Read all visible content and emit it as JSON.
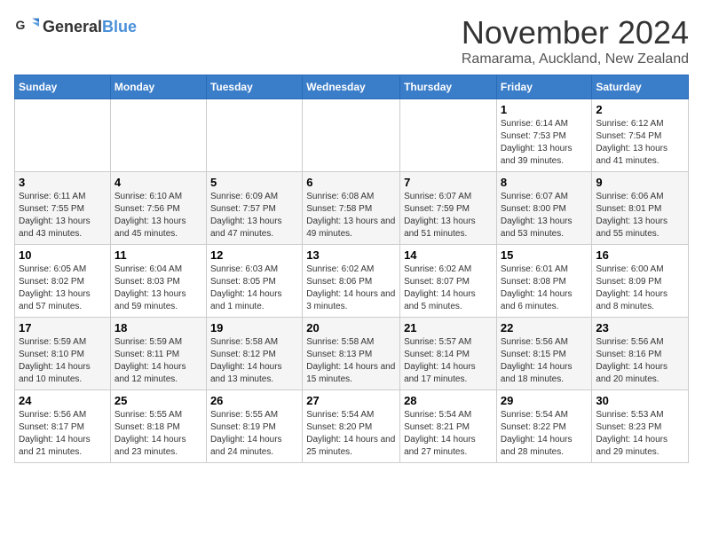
{
  "header": {
    "logo_general": "General",
    "logo_blue": "Blue",
    "title": "November 2024",
    "subtitle": "Ramarama, Auckland, New Zealand"
  },
  "days_of_week": [
    "Sunday",
    "Monday",
    "Tuesday",
    "Wednesday",
    "Thursday",
    "Friday",
    "Saturday"
  ],
  "weeks": [
    [
      {
        "day": "",
        "sunrise": "",
        "sunset": "",
        "daylight": ""
      },
      {
        "day": "",
        "sunrise": "",
        "sunset": "",
        "daylight": ""
      },
      {
        "day": "",
        "sunrise": "",
        "sunset": "",
        "daylight": ""
      },
      {
        "day": "",
        "sunrise": "",
        "sunset": "",
        "daylight": ""
      },
      {
        "day": "",
        "sunrise": "",
        "sunset": "",
        "daylight": ""
      },
      {
        "day": "1",
        "sunrise": "Sunrise: 6:14 AM",
        "sunset": "Sunset: 7:53 PM",
        "daylight": "Daylight: 13 hours and 39 minutes."
      },
      {
        "day": "2",
        "sunrise": "Sunrise: 6:12 AM",
        "sunset": "Sunset: 7:54 PM",
        "daylight": "Daylight: 13 hours and 41 minutes."
      }
    ],
    [
      {
        "day": "3",
        "sunrise": "Sunrise: 6:11 AM",
        "sunset": "Sunset: 7:55 PM",
        "daylight": "Daylight: 13 hours and 43 minutes."
      },
      {
        "day": "4",
        "sunrise": "Sunrise: 6:10 AM",
        "sunset": "Sunset: 7:56 PM",
        "daylight": "Daylight: 13 hours and 45 minutes."
      },
      {
        "day": "5",
        "sunrise": "Sunrise: 6:09 AM",
        "sunset": "Sunset: 7:57 PM",
        "daylight": "Daylight: 13 hours and 47 minutes."
      },
      {
        "day": "6",
        "sunrise": "Sunrise: 6:08 AM",
        "sunset": "Sunset: 7:58 PM",
        "daylight": "Daylight: 13 hours and 49 minutes."
      },
      {
        "day": "7",
        "sunrise": "Sunrise: 6:07 AM",
        "sunset": "Sunset: 7:59 PM",
        "daylight": "Daylight: 13 hours and 51 minutes."
      },
      {
        "day": "8",
        "sunrise": "Sunrise: 6:07 AM",
        "sunset": "Sunset: 8:00 PM",
        "daylight": "Daylight: 13 hours and 53 minutes."
      },
      {
        "day": "9",
        "sunrise": "Sunrise: 6:06 AM",
        "sunset": "Sunset: 8:01 PM",
        "daylight": "Daylight: 13 hours and 55 minutes."
      }
    ],
    [
      {
        "day": "10",
        "sunrise": "Sunrise: 6:05 AM",
        "sunset": "Sunset: 8:02 PM",
        "daylight": "Daylight: 13 hours and 57 minutes."
      },
      {
        "day": "11",
        "sunrise": "Sunrise: 6:04 AM",
        "sunset": "Sunset: 8:03 PM",
        "daylight": "Daylight: 13 hours and 59 minutes."
      },
      {
        "day": "12",
        "sunrise": "Sunrise: 6:03 AM",
        "sunset": "Sunset: 8:05 PM",
        "daylight": "Daylight: 14 hours and 1 minute."
      },
      {
        "day": "13",
        "sunrise": "Sunrise: 6:02 AM",
        "sunset": "Sunset: 8:06 PM",
        "daylight": "Daylight: 14 hours and 3 minutes."
      },
      {
        "day": "14",
        "sunrise": "Sunrise: 6:02 AM",
        "sunset": "Sunset: 8:07 PM",
        "daylight": "Daylight: 14 hours and 5 minutes."
      },
      {
        "day": "15",
        "sunrise": "Sunrise: 6:01 AM",
        "sunset": "Sunset: 8:08 PM",
        "daylight": "Daylight: 14 hours and 6 minutes."
      },
      {
        "day": "16",
        "sunrise": "Sunrise: 6:00 AM",
        "sunset": "Sunset: 8:09 PM",
        "daylight": "Daylight: 14 hours and 8 minutes."
      }
    ],
    [
      {
        "day": "17",
        "sunrise": "Sunrise: 5:59 AM",
        "sunset": "Sunset: 8:10 PM",
        "daylight": "Daylight: 14 hours and 10 minutes."
      },
      {
        "day": "18",
        "sunrise": "Sunrise: 5:59 AM",
        "sunset": "Sunset: 8:11 PM",
        "daylight": "Daylight: 14 hours and 12 minutes."
      },
      {
        "day": "19",
        "sunrise": "Sunrise: 5:58 AM",
        "sunset": "Sunset: 8:12 PM",
        "daylight": "Daylight: 14 hours and 13 minutes."
      },
      {
        "day": "20",
        "sunrise": "Sunrise: 5:58 AM",
        "sunset": "Sunset: 8:13 PM",
        "daylight": "Daylight: 14 hours and 15 minutes."
      },
      {
        "day": "21",
        "sunrise": "Sunrise: 5:57 AM",
        "sunset": "Sunset: 8:14 PM",
        "daylight": "Daylight: 14 hours and 17 minutes."
      },
      {
        "day": "22",
        "sunrise": "Sunrise: 5:56 AM",
        "sunset": "Sunset: 8:15 PM",
        "daylight": "Daylight: 14 hours and 18 minutes."
      },
      {
        "day": "23",
        "sunrise": "Sunrise: 5:56 AM",
        "sunset": "Sunset: 8:16 PM",
        "daylight": "Daylight: 14 hours and 20 minutes."
      }
    ],
    [
      {
        "day": "24",
        "sunrise": "Sunrise: 5:56 AM",
        "sunset": "Sunset: 8:17 PM",
        "daylight": "Daylight: 14 hours and 21 minutes."
      },
      {
        "day": "25",
        "sunrise": "Sunrise: 5:55 AM",
        "sunset": "Sunset: 8:18 PM",
        "daylight": "Daylight: 14 hours and 23 minutes."
      },
      {
        "day": "26",
        "sunrise": "Sunrise: 5:55 AM",
        "sunset": "Sunset: 8:19 PM",
        "daylight": "Daylight: 14 hours and 24 minutes."
      },
      {
        "day": "27",
        "sunrise": "Sunrise: 5:54 AM",
        "sunset": "Sunset: 8:20 PM",
        "daylight": "Daylight: 14 hours and 25 minutes."
      },
      {
        "day": "28",
        "sunrise": "Sunrise: 5:54 AM",
        "sunset": "Sunset: 8:21 PM",
        "daylight": "Daylight: 14 hours and 27 minutes."
      },
      {
        "day": "29",
        "sunrise": "Sunrise: 5:54 AM",
        "sunset": "Sunset: 8:22 PM",
        "daylight": "Daylight: 14 hours and 28 minutes."
      },
      {
        "day": "30",
        "sunrise": "Sunrise: 5:53 AM",
        "sunset": "Sunset: 8:23 PM",
        "daylight": "Daylight: 14 hours and 29 minutes."
      }
    ]
  ]
}
